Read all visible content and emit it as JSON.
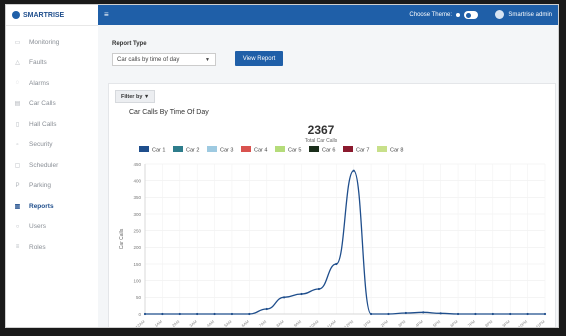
{
  "app": {
    "brand": "SMARTRISE"
  },
  "sidebar": {
    "items": [
      {
        "label": "Monitoring",
        "icon": "monitor-icon",
        "active": false
      },
      {
        "label": "Faults",
        "icon": "warning-icon",
        "active": false
      },
      {
        "label": "Alarms",
        "icon": "bell-icon",
        "active": false
      },
      {
        "label": "Car Calls",
        "icon": "car-icon",
        "active": false
      },
      {
        "label": "Hall Calls",
        "icon": "hall-icon",
        "active": false
      },
      {
        "label": "Security",
        "icon": "lock-icon",
        "active": false
      },
      {
        "label": "Scheduler",
        "icon": "calendar-icon",
        "active": false
      },
      {
        "label": "Parking",
        "icon": "parking-icon",
        "active": false
      },
      {
        "label": "Reports",
        "icon": "report-icon",
        "active": true
      },
      {
        "label": "Users",
        "icon": "user-icon",
        "active": false
      },
      {
        "label": "Roles",
        "icon": "roles-icon",
        "active": false
      }
    ]
  },
  "topbar": {
    "theme_label": "Choose Theme:",
    "user_name": "Smartrise admin"
  },
  "report": {
    "type_label": "Report Type",
    "selected_type": "Car calls by time of day",
    "view_button": "View Report",
    "filter_button": "Filter by ▼",
    "title": "Car Calls By Time Of Day"
  },
  "colors": {
    "primary": "#1f5fa8"
  },
  "chart_data": {
    "type": "line",
    "total_value": "2367",
    "total_label": "Total Car Calls",
    "ylabel": "Car Calls",
    "ylim": [
      0,
      450
    ],
    "yticks": [
      0,
      50,
      100,
      150,
      200,
      250,
      300,
      350,
      400,
      450
    ],
    "series": [
      {
        "name": "Car 1",
        "color": "#1f4e8c"
      },
      {
        "name": "Car 2",
        "color": "#2e7d8c"
      },
      {
        "name": "Car 3",
        "color": "#9ecae1"
      },
      {
        "name": "Car 4",
        "color": "#d9534f"
      },
      {
        "name": "Car 5",
        "color": "#b5dc7a"
      },
      {
        "name": "Car 6",
        "color": "#1a2e1a"
      },
      {
        "name": "Car 7",
        "color": "#8b1a2e"
      },
      {
        "name": "Car 8",
        "color": "#c8e08a"
      }
    ],
    "categories": [
      "12AM",
      "1AM",
      "2AM",
      "3AM",
      "4AM",
      "5AM",
      "6AM",
      "7AM",
      "8AM",
      "9AM",
      "10AM",
      "11AM",
      "12PM",
      "1PM",
      "2PM",
      "3PM",
      "4PM",
      "5PM",
      "6PM",
      "7PM",
      "8PM",
      "9PM",
      "10PM",
      "11PM"
    ],
    "values": [
      0,
      0,
      0,
      0,
      0,
      0,
      0,
      15,
      50,
      60,
      75,
      150,
      430,
      0,
      0,
      3,
      5,
      2,
      0,
      0,
      0,
      0,
      0,
      0
    ]
  }
}
